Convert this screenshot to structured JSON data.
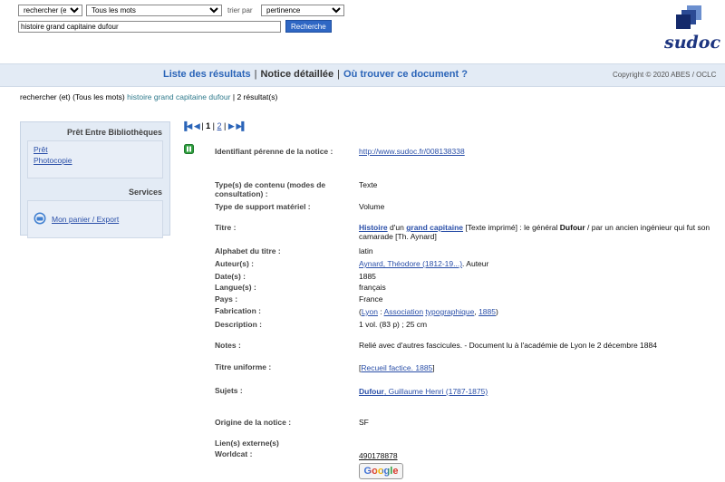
{
  "search": {
    "operator_select": "rechercher (et)",
    "scope_select": "Tous les mots",
    "sort_label": "trier par",
    "sort_select": "pertinence",
    "query": "histoire grand capitaine dufour",
    "button": "Recherche"
  },
  "logo": {
    "text": "sudoc"
  },
  "nav": {
    "results": "Liste des résultats",
    "detail": "Notice détaillée",
    "where": "Où trouver ce document ?",
    "sep": "|",
    "copyright": "Copyright © 2020 ABES / OCLC"
  },
  "breadcrumb": {
    "prefix": "rechercher (et) (Tous les mots)",
    "query": "histoire grand capitaine dufour",
    "sep": "|",
    "count": "2 résultat(s)"
  },
  "sidebar": {
    "peb_title": "Prêt Entre Bibliothèques",
    "peb_links": [
      "Prêt",
      "Photocopie"
    ],
    "services_title": "Services",
    "services_link": "Mon panier / Export"
  },
  "pager": {
    "current": "1",
    "other": "2",
    "sep": "|"
  },
  "record": {
    "ppn_label": "Identifiant pérenne de la notice :",
    "ppn_value": "http://www.sudoc.fr/008138338",
    "content_type_label": "Type(s) de contenu (modes de consultation) :",
    "content_type_value": "Texte",
    "support_label": "Type de support matériel :",
    "support_value": "Volume",
    "title_label": "Titre :",
    "title_part1": "Histoire",
    "title_part2": " d'un ",
    "title_part3": "grand capitaine",
    "title_rest1": " [Texte imprimé] : le général ",
    "title_bold": "Dufour",
    "title_rest2": " / par un ancien ingénieur qui fut son camarade [Th. Aynard]",
    "alphabet_label": "Alphabet du titre :",
    "alphabet_value": "latin",
    "author_label": "Auteur(s) :",
    "author_link": "Aynard, Théodore (1812-19...)",
    "author_role": ". Auteur",
    "date_label": "Date(s) :",
    "date_value": "1885",
    "lang_label": "Langue(s) :",
    "lang_value": "français",
    "country_label": "Pays :",
    "country_value": "France",
    "fab_label": "Fabrication :",
    "fab_open": "(",
    "fab_lyon": "Lyon",
    "fab_sep1": " : ",
    "fab_assoc": "Association",
    "fab_typo": "typographique",
    "fab_sep2": ", ",
    "fab_year": "1885",
    "fab_close": ")",
    "desc_label": "Description :",
    "desc_value": "1 vol. (83 p) ; 25 cm",
    "notes_label": "Notes :",
    "notes_value": "Relié avec d'autres fascicules. - Document lu à l'académie de Lyon le 2 décembre 1884",
    "uniform_label": "Titre uniforme :",
    "uniform_open": "[",
    "uniform_link": "Recueil factice. 1885",
    "uniform_close": "]",
    "subjects_label": "Sujets :",
    "subjects_bold": "Dufour",
    "subjects_rest": ", Guillaume Henri (1787-1875)",
    "origin_label": "Origine de la notice :",
    "origin_value": "SF",
    "links_label": "Lien(s) externe(s)",
    "worldcat_label": "Worldcat :",
    "worldcat_value": "490178878",
    "google_label": "Google"
  }
}
